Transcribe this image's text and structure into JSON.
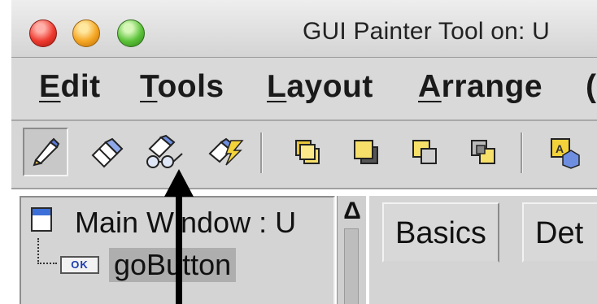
{
  "window": {
    "title": "GUI Painter Tool on: U",
    "traffic_lights": [
      "close",
      "minimize",
      "zoom"
    ]
  },
  "menubar": {
    "items": [
      {
        "mnemonic": "E",
        "rest": "dit"
      },
      {
        "mnemonic": "T",
        "rest": "ools"
      },
      {
        "mnemonic": "L",
        "rest": "ayout"
      },
      {
        "mnemonic": "A",
        "rest": "rrange"
      },
      {
        "mnemonic": "",
        "rest": "("
      }
    ]
  },
  "toolbar": {
    "tools": [
      {
        "icon": "select-pencil-icon",
        "pressed": true
      },
      {
        "icon": "eraser-icon",
        "pressed": false
      },
      {
        "icon": "inspect-spectacles-icon",
        "pressed": false
      },
      {
        "icon": "lightning-edit-icon",
        "pressed": false
      },
      {
        "icon": "bring-to-front-icon",
        "pressed": false
      },
      {
        "icon": "send-to-back-icon",
        "pressed": false
      },
      {
        "icon": "bring-forward-icon",
        "pressed": false
      },
      {
        "icon": "send-backward-icon",
        "pressed": false
      },
      {
        "icon": "widget-shapes-icon",
        "pressed": false
      }
    ]
  },
  "tree": {
    "root_label": "Main Window : U",
    "child_badge": "OK",
    "child_label": "goButton"
  },
  "scrollbar": {
    "up_glyph": "Δ"
  },
  "tabs": [
    "Basics",
    "Det"
  ],
  "colors": {
    "chrome": "#d4d4d4",
    "selection": "#aeaeae",
    "arrow": "#000000"
  }
}
